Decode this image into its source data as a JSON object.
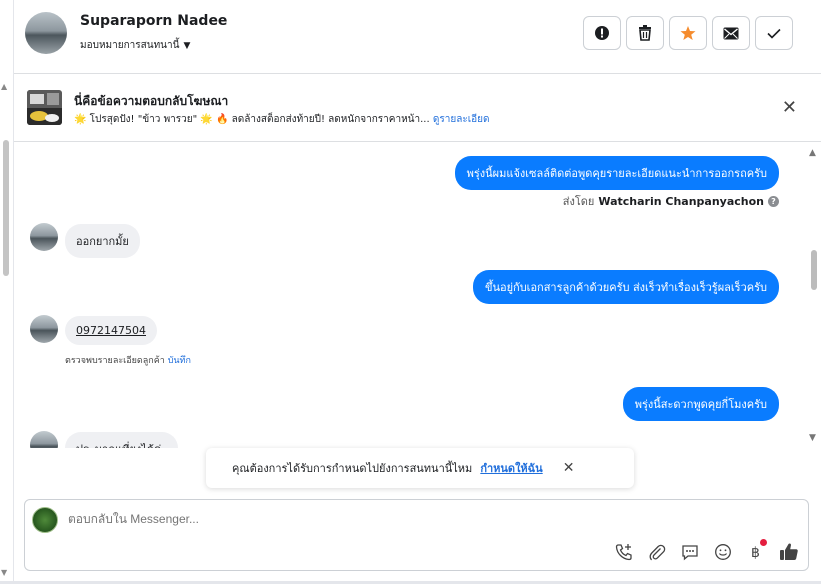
{
  "header": {
    "contact_name": "Suparaporn Nadee",
    "assign_label": "มอบหมายการสนทนานี้"
  },
  "ad_banner": {
    "title": "นี่คือข้อความตอบกลับโฆษณา",
    "subtitle": "🌟 โปรสุดปัง! \"ข้าว พารวย\" 🌟 🔥 ลดล้างสต็อกส่งท้ายปี! ลดหนักจากราคาหน้า...",
    "details_link": "ดูรายละเอียด"
  },
  "messages": {
    "m1": "พรุ่งนี้ผมแจ้งเซลล์ติดต่อพูดคุยรายละเอียดแนะนำการออกรถครับ",
    "sent_by_prefix": "ส่งโดย",
    "sent_by_name": "Watcharin Chanpanyachon",
    "m2": "ออกยากมั้ย",
    "m3": "ขึ้นอยู่กับเอกสารลูกค้าด้วยครับ ส่งเร็วทำเรื่องเร็วรู้ผลเร็วครับ",
    "m4": "0972147504",
    "note_text": "ตรวจพบรายละเอียดลูกค้า",
    "note_link": "บันทึก",
    "m5": "พรุ่งนี้สะดวกพูดคุยกี่โมงครับ",
    "m6": "ประมาณเที่ยงได้ค่ะ"
  },
  "toast": {
    "text": "คุณต้องการได้รับการกำหนดไปยังการสนทนานี้ไหม",
    "link": "กำหนดให้ฉัน"
  },
  "composer": {
    "placeholder": "ตอบกลับใน Messenger..."
  },
  "colors": {
    "accent": "#0a7cff",
    "link": "#216fdb",
    "star": "#f58c2e"
  }
}
